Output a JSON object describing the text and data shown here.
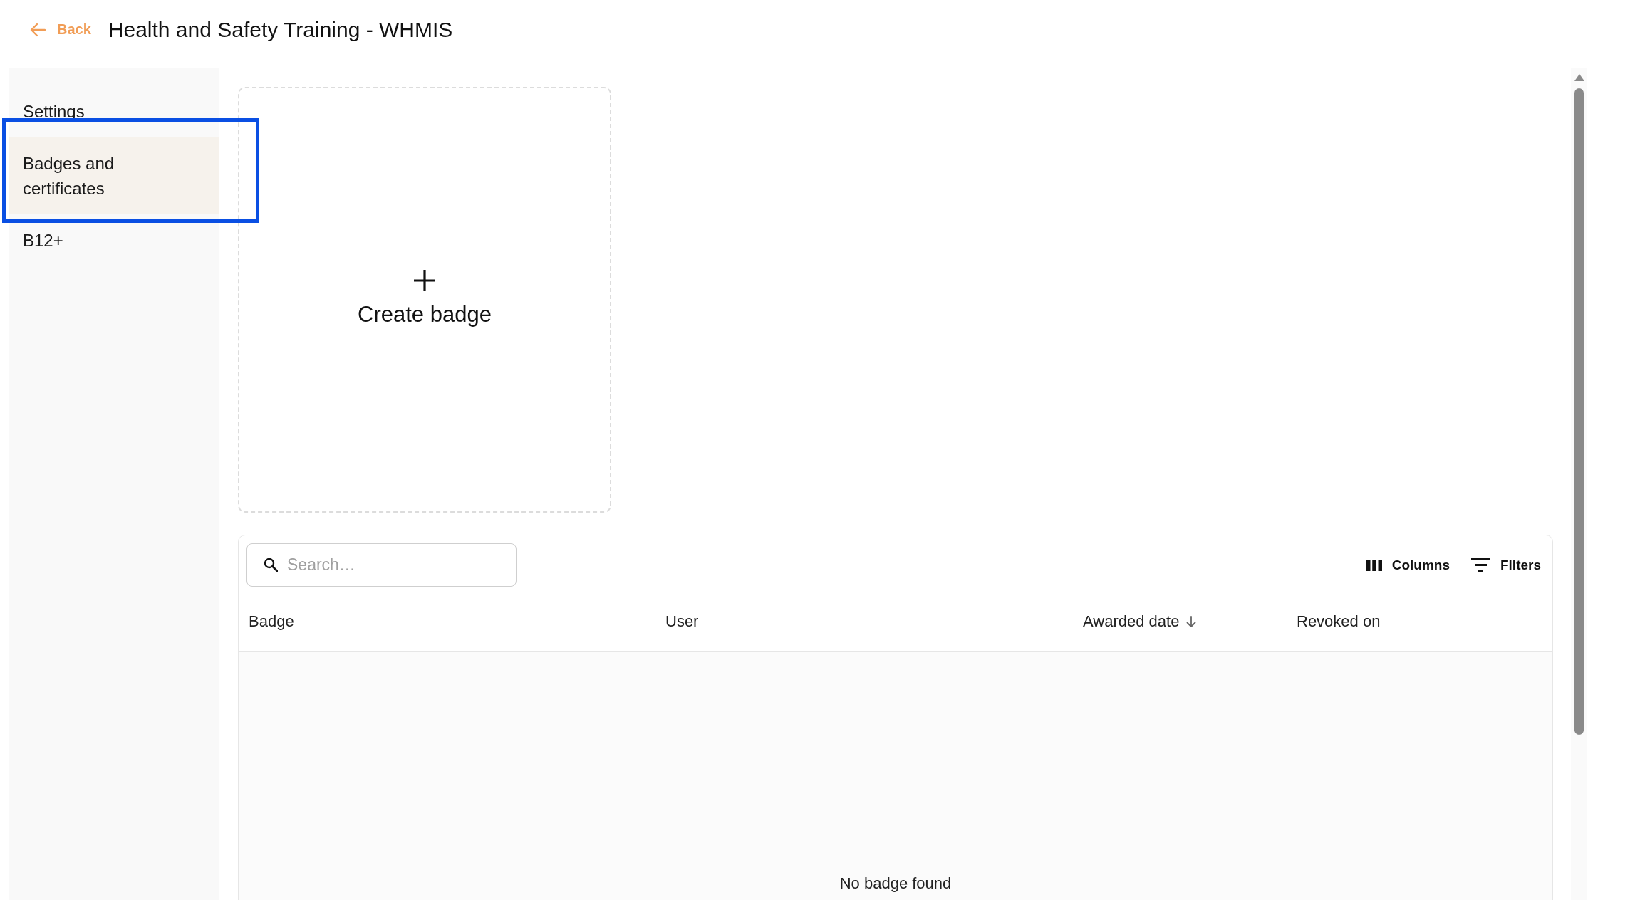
{
  "header": {
    "back_label": "Back",
    "title": "Health and Safety Training - WHMIS"
  },
  "sidebar": {
    "items": [
      {
        "label": "Settings",
        "selected": false,
        "outlined": false
      },
      {
        "label": "Badges and certificates",
        "selected": true,
        "outlined": true
      },
      {
        "label": "B12+",
        "selected": false,
        "outlined": false
      }
    ]
  },
  "create_card": {
    "label": "Create badge"
  },
  "table": {
    "search": {
      "placeholder": "Search…"
    },
    "tools": [
      {
        "kind": "columns",
        "label": "Columns"
      },
      {
        "kind": "filters",
        "label": "Filters"
      }
    ],
    "columns": [
      {
        "label": "Badge",
        "sorted": false
      },
      {
        "label": "User",
        "sorted": false
      },
      {
        "label": "Awarded date",
        "sorted": true
      },
      {
        "label": "Revoked on",
        "sorted": false
      }
    ],
    "empty_message": "No badge found"
  }
}
